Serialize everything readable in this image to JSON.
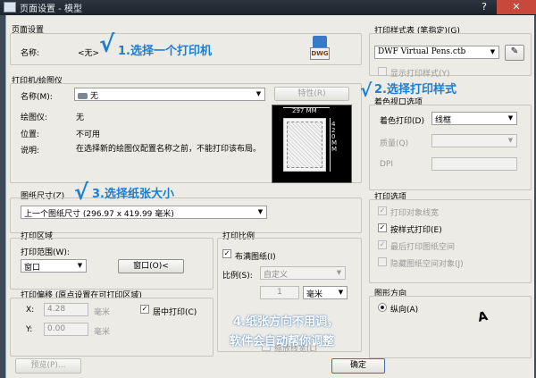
{
  "window": {
    "title": "页面设置 - 模型",
    "help": "?",
    "close": "✕"
  },
  "page_setup": {
    "group_label": "页面设置",
    "name_label": "名称:",
    "name_value": "<无>",
    "icon_text": "DWG"
  },
  "printer": {
    "group_label": "打印机/绘图仪",
    "name_label": "名称(M):",
    "name_value": "无",
    "properties_button": "特性(R)",
    "plotter_label": "绘图仪:",
    "plotter_value": "无",
    "location_label": "位置:",
    "location_value": "不可用",
    "description_label": "说明:",
    "description_value": "在选择新的绘图仪配置名称之前，不能打印该布局。",
    "preview": {
      "width_label": "297 MM",
      "height_label": "420 MM"
    }
  },
  "paper_size": {
    "label": "图纸尺寸(Z)",
    "value": "上一个图纸尺寸 (296.97 x 419.99 毫米)"
  },
  "plot_area": {
    "group_label": "打印区域",
    "range_label": "打印范围(W):",
    "range_value": "窗口",
    "window_button": "窗口(O)<"
  },
  "plot_offset": {
    "group_label": "打印偏移 (原点设置在可打印区域)",
    "x_label": "X:",
    "x_value": "4.28",
    "x_unit": "毫米",
    "y_label": "Y:",
    "y_value": "0.00",
    "y_unit": "毫米",
    "center_label": "居中打印(C)",
    "center_checked": true
  },
  "plot_scale": {
    "group_label": "打印比例",
    "fit_label": "布满图纸(I)",
    "fit_checked": true,
    "scale_label": "比例(S):",
    "scale_value": "自定义",
    "value1": "1",
    "unit_value": "毫米",
    "lineweight_label": "缩放线宽(L)"
  },
  "plot_style": {
    "group_label": "打印样式表 (笔指定)(G)",
    "value": "DWF Virtual Pens.ctb",
    "display_label": "显示打印样式(Y)"
  },
  "shaded_viewport": {
    "group_label": "着色视口选项",
    "shade_label": "着色打印(D)",
    "shade_value": "线框",
    "quality_label": "质量(Q)",
    "dpi_label": "DPI"
  },
  "plot_options": {
    "group_label": "打印选项",
    "items": [
      {
        "label": "打印对象线宽",
        "checked": true,
        "enabled": false
      },
      {
        "label": "按样式打印(E)",
        "checked": true,
        "enabled": true
      },
      {
        "label": "最后打印图纸空间",
        "checked": true,
        "enabled": false
      },
      {
        "label": "隐藏图纸空间对象(J)",
        "checked": false,
        "enabled": false
      }
    ]
  },
  "orientation": {
    "group_label": "图形方向",
    "portrait_label": "纵向(A)",
    "icon_letter": "A"
  },
  "footer": {
    "preview_button": "预览(P)...",
    "ok_button": "确定"
  },
  "annotations": {
    "step1": "1.选择一个打印机",
    "step2": "2.选择打印样式",
    "step3": "3.选择纸张大小",
    "step4_line1": "4.纸张方向不用调，",
    "step4_line2": "软件会自动帮你调整"
  }
}
